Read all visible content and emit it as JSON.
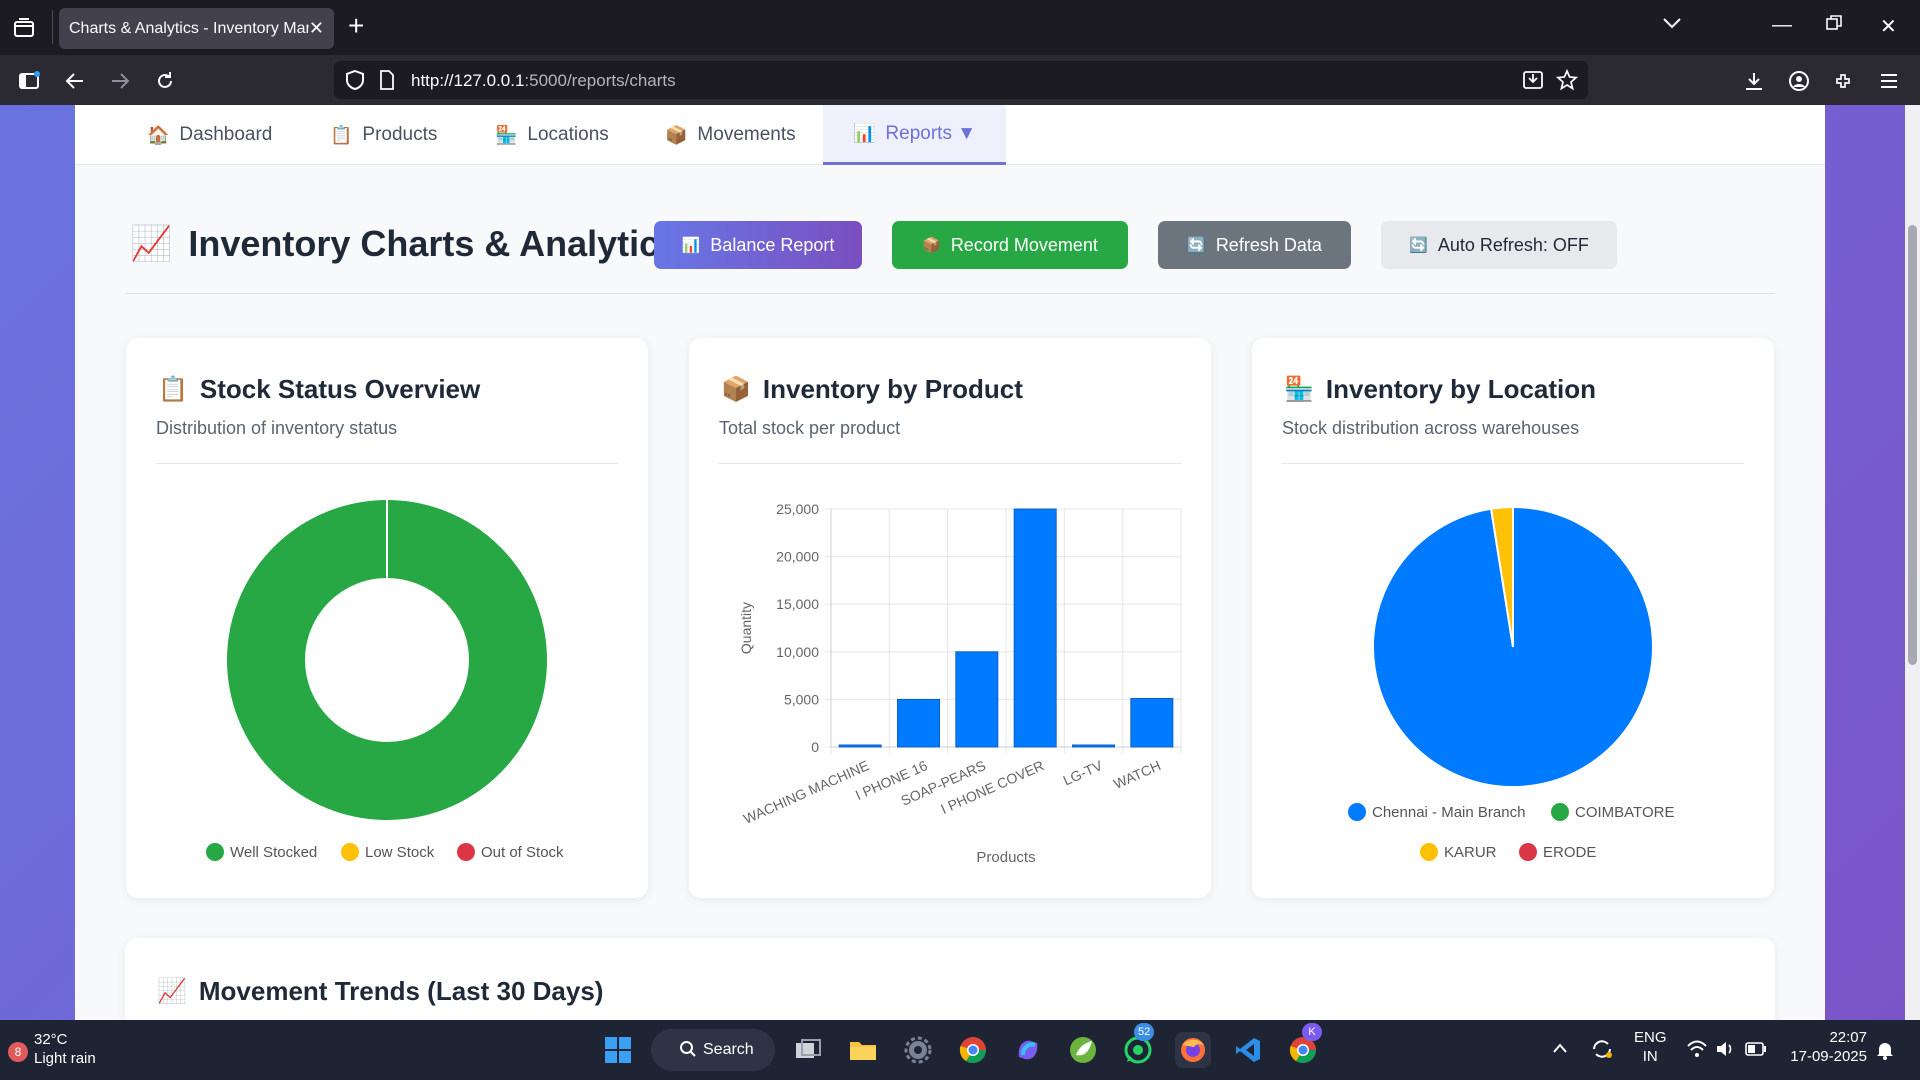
{
  "browser": {
    "tab_title": "Charts & Analytics - Inventory Management",
    "url_host": "http://127.0.0.1",
    "url_rest": ":5000/reports/charts"
  },
  "nav": {
    "items": [
      {
        "icon": "🏠",
        "label": "Dashboard"
      },
      {
        "icon": "📋",
        "label": "Products"
      },
      {
        "icon": "🏪",
        "label": "Locations"
      },
      {
        "icon": "📦",
        "label": "Movements"
      },
      {
        "icon": "📊",
        "label": "Reports ▼"
      }
    ]
  },
  "header": {
    "icon": "📈",
    "title": "Inventory Charts & Analytics",
    "buttons": {
      "balance": {
        "icon": "📊",
        "label": "Balance Report"
      },
      "record": {
        "icon": "📦",
        "label": "Record Movement"
      },
      "refresh": {
        "icon": "🔄",
        "label": "Refresh Data"
      },
      "auto": {
        "icon": "🔄",
        "label": "Auto Refresh: OFF"
      }
    }
  },
  "cards": {
    "status": {
      "icon": "📋",
      "title": "Stock Status Overview",
      "subtitle": "Distribution of inventory status"
    },
    "product": {
      "icon": "📦",
      "title": "Inventory by Product",
      "subtitle": "Total stock per product"
    },
    "location": {
      "icon": "🏪",
      "title": "Inventory by Location",
      "subtitle": "Stock distribution across warehouses"
    },
    "trends": {
      "icon": "📈",
      "title": "Movement Trends (Last 30 Days)"
    }
  },
  "chart_data": [
    {
      "type": "pie",
      "variant": "doughnut",
      "labels": [
        "Well Stocked",
        "Low Stock",
        "Out of Stock"
      ],
      "values": [
        100,
        0,
        0
      ],
      "colors": [
        "#28a745",
        "#ffc107",
        "#dc3545"
      ],
      "legend": "bottom"
    },
    {
      "type": "bar",
      "categories": [
        "WACHING MACHINE",
        "I PHONE 16",
        "SOAP-PEARS",
        "I PHONE COVER",
        "LG-TV",
        "WATCH"
      ],
      "values": [
        200,
        5000,
        10000,
        25000,
        100,
        5100
      ],
      "xlabel": "Products",
      "ylabel": "Quantity",
      "ylim": [
        0,
        25000
      ],
      "yticks": [
        "25,000",
        "20,000",
        "15,000",
        "10,000",
        "5,000",
        "0"
      ],
      "color": "#007bff",
      "grid": true
    },
    {
      "type": "pie",
      "labels": [
        "Chennai - Main Branch",
        "COIMBATORE",
        "KARUR",
        "ERODE"
      ],
      "values": [
        97.5,
        0,
        2.5,
        0
      ],
      "colors": [
        "#007bff",
        "#28a745",
        "#ffc107",
        "#dc3545"
      ],
      "legend": "bottom"
    }
  ],
  "taskbar": {
    "temp": "32°C",
    "weather": "Light rain",
    "weather_badge": "8",
    "search": "Search",
    "whatsapp_badge": "52",
    "chrome_badge": "K",
    "lang1": "ENG",
    "lang2": "IN",
    "time": "22:07",
    "date": "17-09-2025"
  }
}
